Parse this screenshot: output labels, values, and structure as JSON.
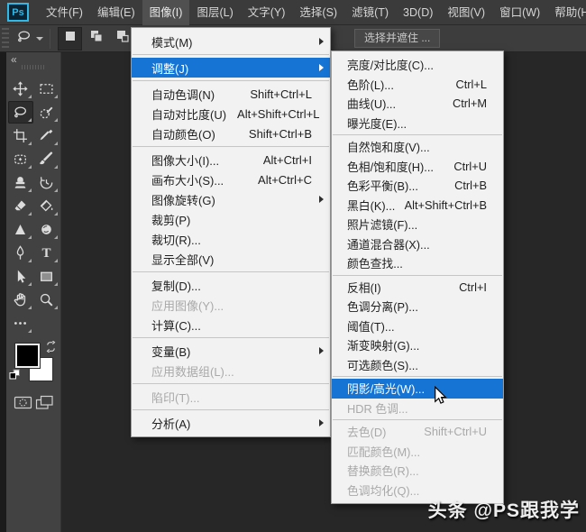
{
  "app": {
    "logo_text": "Ps"
  },
  "colors": {
    "highlight_blue": "#1574d4",
    "menu_background": "#f2f2f2",
    "dark_ui": "#3b3b3b",
    "panel": "#424242"
  },
  "menu_bar": {
    "active_index": 2,
    "items": [
      {
        "name": "file",
        "label": "文件(F)"
      },
      {
        "name": "edit",
        "label": "编辑(E)"
      },
      {
        "name": "image",
        "label": "图像(I)"
      },
      {
        "name": "layer",
        "label": "图层(L)"
      },
      {
        "name": "type",
        "label": "文字(Y)"
      },
      {
        "name": "select",
        "label": "选择(S)"
      },
      {
        "name": "filter",
        "label": "滤镜(T)"
      },
      {
        "name": "3d",
        "label": "3D(D)"
      },
      {
        "name": "view",
        "label": "视图(V)"
      },
      {
        "name": "window",
        "label": "窗口(W)"
      },
      {
        "name": "help",
        "label": "帮助(H)"
      }
    ]
  },
  "options_bar": {
    "select_and_mask_label": "选择并遮住 ...",
    "selection_modes": [
      {
        "name": "new-selection",
        "pressed": true
      },
      {
        "name": "add-to-selection",
        "pressed": false
      },
      {
        "name": "subtract-from-selection",
        "pressed": false
      }
    ]
  },
  "image_menu": {
    "items": [
      {
        "name": "mode",
        "label": "模式(M)",
        "arrow": true
      },
      {
        "type": "sep"
      },
      {
        "name": "adjustments",
        "label": "调整(J)",
        "arrow": true,
        "highlighted": true
      },
      {
        "type": "sep"
      },
      {
        "name": "auto-tone",
        "label": "自动色调(N)",
        "shortcut": "Shift+Ctrl+L"
      },
      {
        "name": "auto-contrast",
        "label": "自动对比度(U)",
        "shortcut": "Alt+Shift+Ctrl+L"
      },
      {
        "name": "auto-color",
        "label": "自动颜色(O)",
        "shortcut": "Shift+Ctrl+B"
      },
      {
        "type": "sep"
      },
      {
        "name": "image-size",
        "label": "图像大小(I)...",
        "shortcut": "Alt+Ctrl+I"
      },
      {
        "name": "canvas-size",
        "label": "画布大小(S)...",
        "shortcut": "Alt+Ctrl+C"
      },
      {
        "name": "image-rotation",
        "label": "图像旋转(G)",
        "arrow": true
      },
      {
        "name": "crop",
        "label": "裁剪(P)"
      },
      {
        "name": "trim",
        "label": "裁切(R)..."
      },
      {
        "name": "reveal-all",
        "label": "显示全部(V)"
      },
      {
        "type": "sep"
      },
      {
        "name": "duplicate",
        "label": "复制(D)..."
      },
      {
        "name": "apply-image",
        "label": "应用图像(Y)...",
        "disabled": true
      },
      {
        "name": "calculations",
        "label": "计算(C)..."
      },
      {
        "type": "sep"
      },
      {
        "name": "variables",
        "label": "变量(B)",
        "arrow": true
      },
      {
        "name": "apply-data-set",
        "label": "应用数据组(L)...",
        "disabled": true
      },
      {
        "type": "sep"
      },
      {
        "name": "trap",
        "label": "陷印(T)...",
        "disabled": true
      },
      {
        "type": "sep"
      },
      {
        "name": "analysis",
        "label": "分析(A)",
        "arrow": true
      }
    ]
  },
  "adjust_submenu": {
    "items": [
      {
        "name": "brightness-contrast",
        "label": "亮度/对比度(C)..."
      },
      {
        "name": "levels",
        "label": "色阶(L)...",
        "shortcut": "Ctrl+L"
      },
      {
        "name": "curves",
        "label": "曲线(U)...",
        "shortcut": "Ctrl+M"
      },
      {
        "name": "exposure",
        "label": "曝光度(E)..."
      },
      {
        "type": "sep"
      },
      {
        "name": "vibrance",
        "label": "自然饱和度(V)..."
      },
      {
        "name": "hue-saturation",
        "label": "色相/饱和度(H)...",
        "shortcut": "Ctrl+U"
      },
      {
        "name": "color-balance",
        "label": "色彩平衡(B)...",
        "shortcut": "Ctrl+B"
      },
      {
        "name": "black-white",
        "label": "黑白(K)...",
        "shortcut": "Alt+Shift+Ctrl+B"
      },
      {
        "name": "photo-filter",
        "label": "照片滤镜(F)..."
      },
      {
        "name": "channel-mixer",
        "label": "通道混合器(X)..."
      },
      {
        "name": "color-lookup",
        "label": "颜色查找..."
      },
      {
        "type": "sep"
      },
      {
        "name": "invert",
        "label": "反相(I)",
        "shortcut": "Ctrl+I"
      },
      {
        "name": "posterize",
        "label": "色调分离(P)..."
      },
      {
        "name": "threshold",
        "label": "阈值(T)..."
      },
      {
        "name": "gradient-map",
        "label": "渐变映射(G)..."
      },
      {
        "name": "selective-color",
        "label": "可选颜色(S)..."
      },
      {
        "type": "sep"
      },
      {
        "name": "shadows-highlights",
        "label": "阴影/高光(W)...",
        "highlighted": true
      },
      {
        "name": "hdr-toning",
        "label": "HDR 色调...",
        "disabled": true
      },
      {
        "type": "sep"
      },
      {
        "name": "desaturate",
        "label": "去色(D)",
        "shortcut": "Shift+Ctrl+U",
        "disabled": true
      },
      {
        "name": "match-color",
        "label": "匹配颜色(M)...",
        "disabled": true
      },
      {
        "name": "replace-color",
        "label": "替换颜色(R)...",
        "disabled": true
      },
      {
        "name": "equalize",
        "label": "色调均化(Q)...",
        "disabled": true
      }
    ]
  },
  "toolbar": {
    "tools": [
      {
        "name": "move-tool"
      },
      {
        "name": "rectangular-marquee-tool"
      },
      {
        "name": "lasso-tool",
        "active": true
      },
      {
        "name": "quick-selection-tool"
      },
      {
        "name": "crop-tool"
      },
      {
        "name": "eyedropper-tool"
      },
      {
        "name": "spot-healing-brush-tool"
      },
      {
        "name": "brush-tool"
      },
      {
        "name": "clone-stamp-tool"
      },
      {
        "name": "history-brush-tool"
      },
      {
        "name": "eraser-tool"
      },
      {
        "name": "paint-bucket-tool"
      },
      {
        "name": "blur-tool"
      },
      {
        "name": "dodge-tool"
      },
      {
        "name": "pen-tool"
      },
      {
        "name": "type-tool"
      },
      {
        "name": "path-selection-tool"
      },
      {
        "name": "rectangle-tool"
      },
      {
        "name": "hand-tool"
      },
      {
        "name": "zoom-tool"
      },
      {
        "name": "edit-toolbar"
      }
    ]
  },
  "watermark": {
    "text": "头条 @PS跟我学"
  }
}
